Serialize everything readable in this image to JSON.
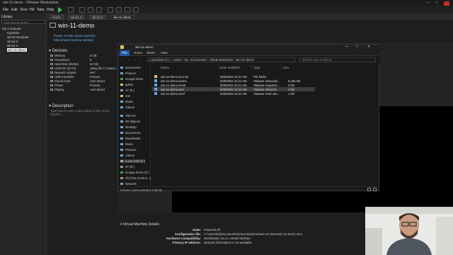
{
  "window": {
    "title": "win-11-demo - VMware Workstation",
    "min": "—",
    "max": "□",
    "close": "✕"
  },
  "menu": [
    "File",
    "Edit",
    "View",
    "VM",
    "Tabs",
    "Help"
  ],
  "library": {
    "header": "Library",
    "search_placeholder": "Type here to search",
    "items": [
      "My Computer",
      "Kali2022",
      "win10-template",
      "win11-2",
      "win11-3",
      "win-11-demo"
    ]
  },
  "tabs": [
    "Home",
    "win11-2",
    "win11-3",
    "win-11-demo"
  ],
  "vm": {
    "title": "win-11-demo",
    "actions": [
      "Power on this virtual machine",
      "Edit virtual machine settings"
    ],
    "devices_header": "Devices",
    "devices": [
      {
        "name": "Memory",
        "value": "8 GB"
      },
      {
        "name": "Processors",
        "value": "8"
      },
      {
        "name": "Hard Disk (NVMe)",
        "value": "64 GB"
      },
      {
        "name": "CD/DVD (SATA)",
        "value": "Using file C:\\Users\\..."
      },
      {
        "name": "Network Adapter",
        "value": "NAT"
      },
      {
        "name": "USB Controller",
        "value": "Present"
      },
      {
        "name": "Sound Card",
        "value": "Auto detect"
      },
      {
        "name": "Printer",
        "value": "Present"
      },
      {
        "name": "Display",
        "value": "Auto detect"
      }
    ],
    "description_header": "Description",
    "description_placeholder": "Type here to enter a description of this virtual machine.",
    "details_header": "Virtual Machine Details",
    "details": [
      {
        "label": "State:",
        "value": "Powered off"
      },
      {
        "label": "Configuration file:",
        "value": "C:\\Users\\mj\\Documents\\Virtual Machines\\win-11-demo\\win-11-demo.vmx"
      },
      {
        "label": "Hardware compatibility:",
        "value": "Workstation 16.2.x virtual machine"
      },
      {
        "label": "Primary IP address:",
        "value": "Network information is not available"
      }
    ]
  },
  "explorer": {
    "title": "win-11-demo",
    "ribbon_tabs": [
      "File",
      "Home",
      "Share",
      "View"
    ],
    "breadcrumb": "Local Disk (C:)  ›  Users  ›  mj  ›  Documents  ›  Virtual Machines  ›  win-11-demo",
    "search_placeholder": "Search win-11-demo",
    "nav": [
      "Documents",
      "Pictures",
      "Google Drive",
      "gdrive",
      "4T (E:)",
      "mm",
      "Music",
      "Videos",
      "This PC",
      "3D Objects",
      "Desktop",
      "Documents",
      "Downloads",
      "Music",
      "Pictures",
      "Videos",
      "Local Disk (C:)",
      "4T (E:)",
      "Google Drive (G:)",
      "nfs (\\\\10.10.60.2...)",
      "Network"
    ],
    "columns": [
      "Name",
      "Date modified",
      "Type",
      "Size"
    ],
    "files": [
      {
        "name": "win-11-demo.vmx.lck",
        "date": "6/28/2022 10:21 AM",
        "type": "File folder",
        "size": ""
      },
      {
        "name": "win-11-demo.nvram",
        "date": "6/28/2022 10:21 AM",
        "type": "VMware virtual dis...",
        "size": "8,256 KB"
      },
      {
        "name": "win-11-demo.vmsd",
        "date": "6/28/2022 10:21 AM",
        "type": "VMware snapshot ...",
        "size": "0 KB"
      },
      {
        "name": "win-11-demo.vmx",
        "date": "6/28/2022 10:22 AM",
        "type": "VMware virtual m...",
        "size": "2 KB"
      },
      {
        "name": "win-11-demo.vmxf",
        "date": "6/28/2022 10:21 AM",
        "type": "VMware Team Me...",
        "size": "1 KB"
      }
    ],
    "status": "5 items    1 item selected  1.90 KB"
  },
  "colors": {
    "accent": "#1a5aa6",
    "link": "#6db3f2",
    "play": "#3cbc4a",
    "close_red": "#d32a2a"
  }
}
